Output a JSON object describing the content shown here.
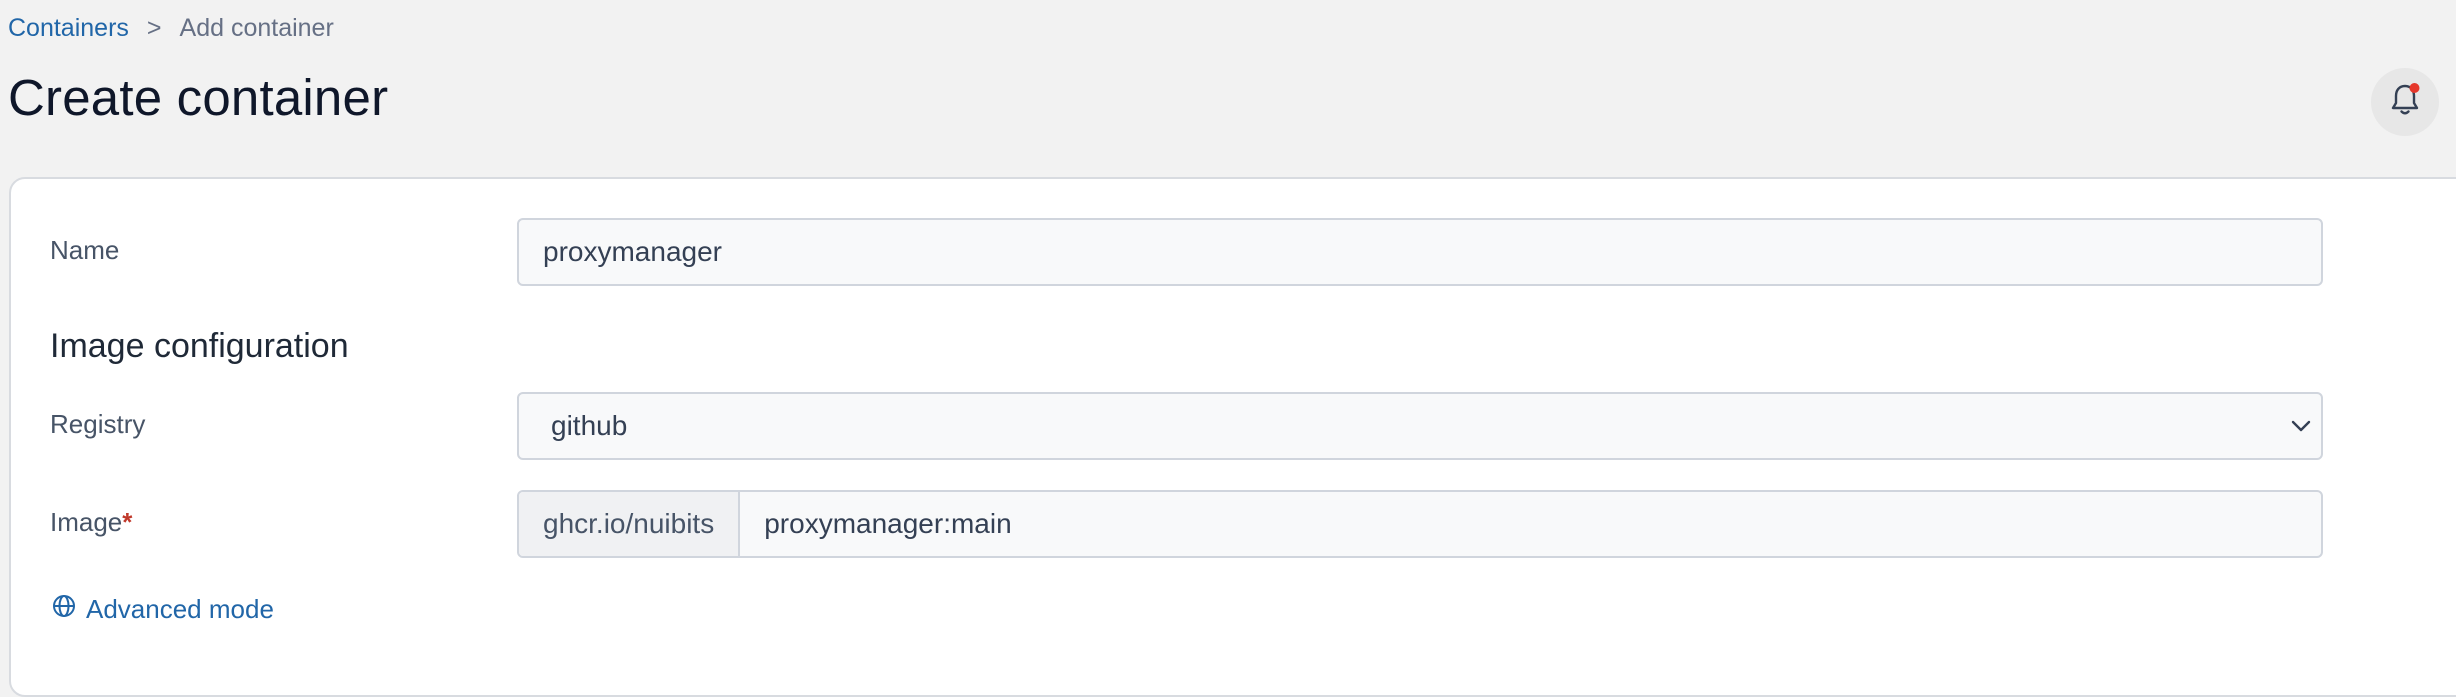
{
  "breadcrumb": {
    "parent": "Containers",
    "separator": ">",
    "current": "Add container"
  },
  "page": {
    "title": "Create container"
  },
  "header": {
    "notification_icon": "bell-icon",
    "notification_badge_color": "#e5372b"
  },
  "form": {
    "name": {
      "label": "Name",
      "value": "proxymanager"
    },
    "image_section": {
      "heading": "Image configuration"
    },
    "registry": {
      "label": "Registry",
      "selected": "github"
    },
    "image": {
      "label": "Image",
      "required_marker": "*",
      "prefix": "ghcr.io/nuibits",
      "value": "proxymanager:main"
    },
    "advanced_mode": {
      "label": "Advanced mode",
      "icon": "globe-icon"
    }
  },
  "colors": {
    "link": "#2166a8",
    "required": "#c0392b"
  }
}
